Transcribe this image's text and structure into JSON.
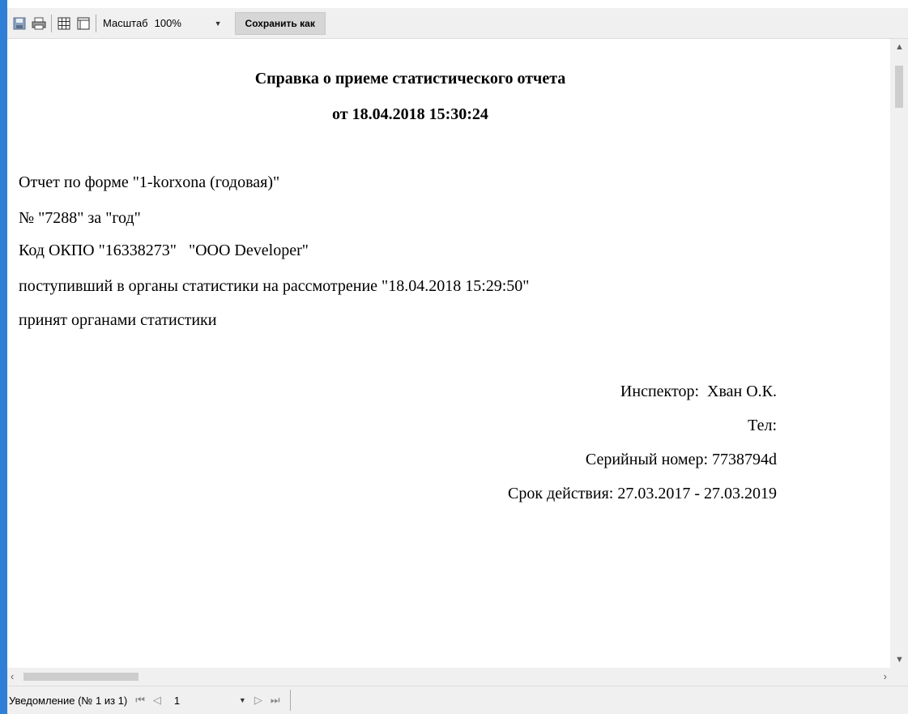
{
  "toolbar": {
    "icons": [
      "save-icon",
      "print-icon",
      "grid-icon",
      "page-setup-icon"
    ],
    "zoom_label": "Масштаб",
    "zoom_value": "100%",
    "save_as_label": "Сохранить как"
  },
  "report": {
    "title": "Справка о приеме статистического отчета",
    "subtitle": "от 18.04.2018 15:30:24",
    "lines": [
      "Отчет по форме \"1-korxona (годовая)\"",
      "№ \"7288\" за \"год\"",
      "Код ОКПО \"16338273\"   \"OOO Developer\"",
      "поступивший в органы статистики на рассмотрение \"18.04.2018 15:29:50\"",
      "принят органами статистики"
    ],
    "inspector": "Инспектор:  Хван О.К.",
    "phone": "Тел:",
    "serial": "Серийный номер: 7738794d",
    "validity": "Срок действия: 27.03.2017 - 27.03.2019"
  },
  "status": {
    "label": "Уведомление (№ 1 из 1)",
    "page_value": "1"
  },
  "colors": {
    "window_edge": "#2f7fd6",
    "toolbar_bg": "#f0f0f0",
    "save_button_bg": "#d6d6d6"
  }
}
